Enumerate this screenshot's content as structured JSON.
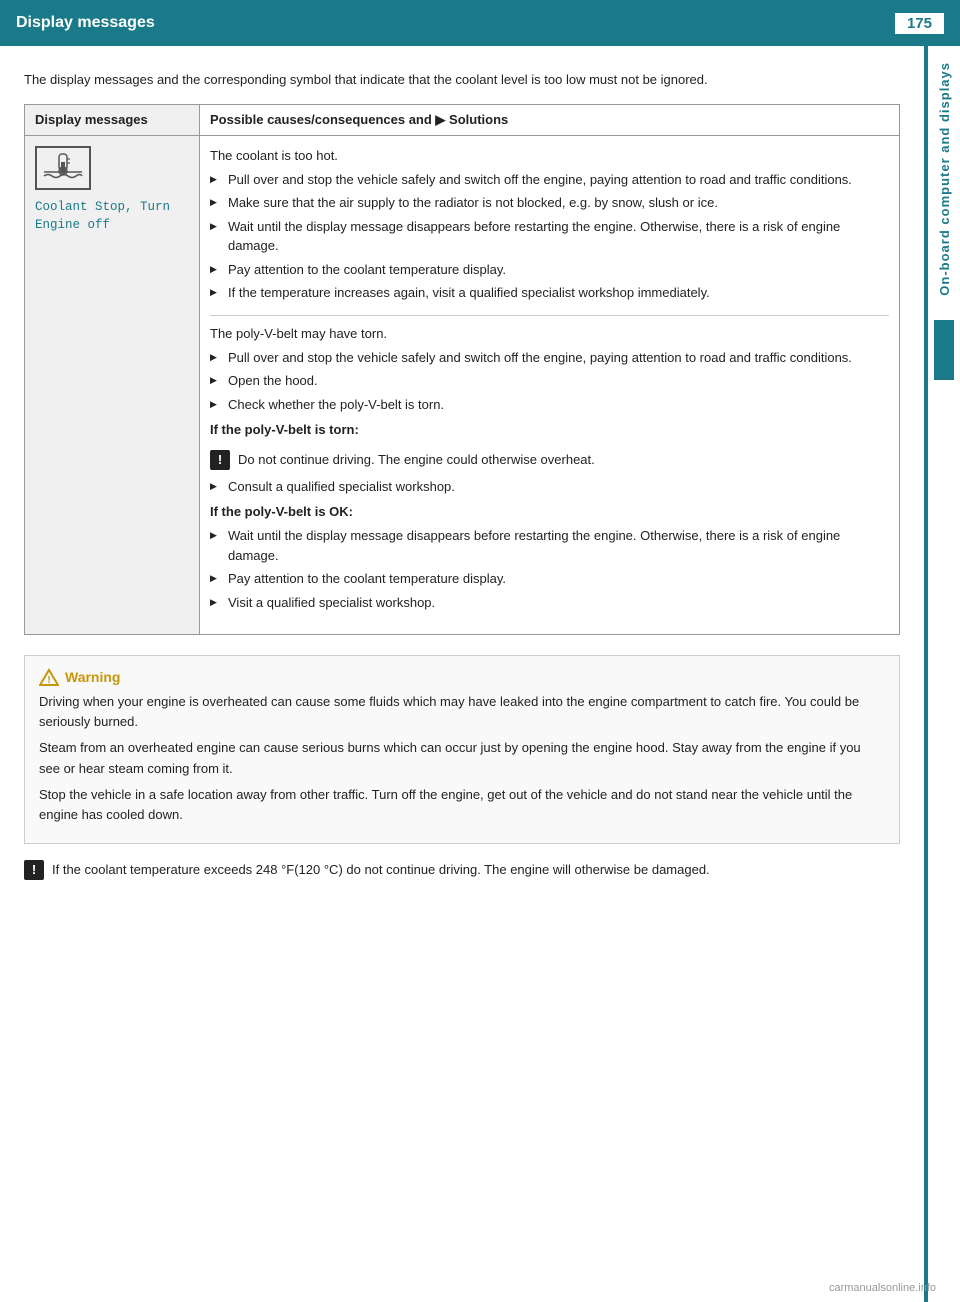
{
  "header": {
    "title": "Display messages",
    "page_number": "175"
  },
  "sidebar": {
    "label": "On-board computer and displays"
  },
  "intro": {
    "text": "The display messages and the corresponding symbol that indicate that the coolant level is too low must not be ignored."
  },
  "table": {
    "col1_header": "Display messages",
    "col2_header": "Possible causes/consequences and ▶ Solutions",
    "row": {
      "display_msg": "Coolant Stop, Turn\nEngine off",
      "section1": {
        "lead": "The coolant is too hot.",
        "bullets": [
          "Pull over and stop the vehicle safely and switch off the engine, paying attention to road and traffic conditions.",
          "Make sure that the air supply to the radiator is not blocked, e.g. by snow, slush or ice.",
          "Wait until the display message disappears before restarting the engine. Otherwise, there is a risk of engine damage.",
          "Pay attention to the coolant temperature display.",
          "If the temperature increases again, visit a qualified specialist workshop immediately."
        ]
      },
      "section2": {
        "lead": "The poly-V-belt may have torn.",
        "bullets": [
          "Pull over and stop the vehicle safely and switch off the engine, paying attention to road and traffic conditions.",
          "Open the hood.",
          "Check whether the poly-V-belt is torn."
        ],
        "subheading1": "If the poly-V-belt is torn:",
        "hazard": "Do not continue driving. The engine could otherwise overheat.",
        "bullet_after_hazard": "Consult a qualified specialist workshop.",
        "subheading2": "If the poly-V-belt is OK:",
        "bullets2": [
          "Wait until the display message disappears before restarting the engine. Otherwise, there is a risk of engine damage.",
          "Pay attention to the coolant temperature display.",
          "Visit a qualified specialist workshop."
        ]
      }
    }
  },
  "warning_box": {
    "title": "Warning",
    "paragraphs": [
      "Driving when your engine is overheated can cause some fluids which may have leaked into the engine compartment to catch fire. You could be seriously burned.",
      "Steam from an overheated engine can cause serious burns which can occur just by opening the engine hood. Stay away from the engine if you see or hear steam coming from it.",
      "Stop the vehicle in a safe location away from other traffic. Turn off the engine, get out of the vehicle and do not stand near the vehicle until the engine has cooled down."
    ]
  },
  "bottom_note": {
    "text": "If the coolant temperature exceeds 248 °F(120 °C) do not continue driving. The engine will otherwise be damaged."
  },
  "footer": {
    "watermark": "carmanualsonline.info"
  }
}
